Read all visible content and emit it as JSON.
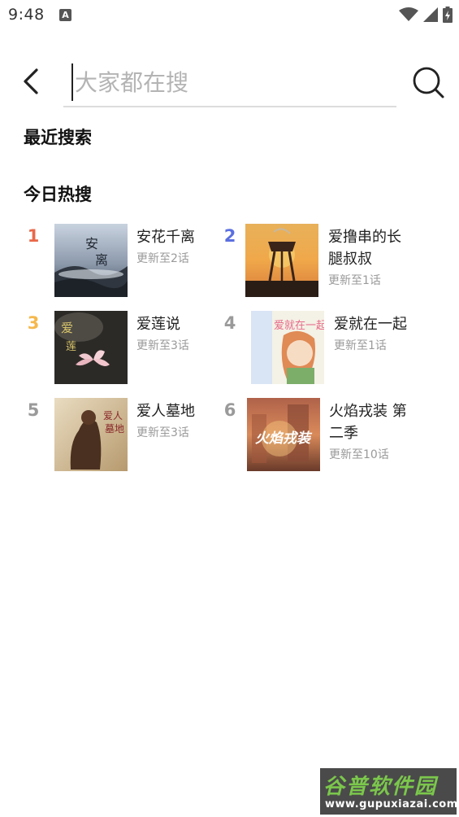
{
  "status_bar": {
    "time": "9:48",
    "notification_icon": "A"
  },
  "search": {
    "placeholder": "大家都在搜",
    "value": ""
  },
  "recent": {
    "title": "最近搜索"
  },
  "hot": {
    "title": "今日热搜",
    "items": [
      {
        "rank": "1",
        "rank_color": "#e8684a",
        "title": "安花千离",
        "title_line2": "",
        "update": "更新至2话"
      },
      {
        "rank": "2",
        "rank_color": "#5b6fe0",
        "title": "爱撸串的长",
        "title_line2": "腿叔叔",
        "update": "更新至1话"
      },
      {
        "rank": "3",
        "rank_color": "#f5b84c",
        "title": "爱莲说",
        "title_line2": "",
        "update": "更新至3话"
      },
      {
        "rank": "4",
        "rank_color": "#9a9a9a",
        "title": "爱就在一起",
        "title_line2": "",
        "update": "更新至1话"
      },
      {
        "rank": "5",
        "rank_color": "#9a9a9a",
        "title": "爱人墓地",
        "title_line2": "",
        "update": "更新至3话"
      },
      {
        "rank": "6",
        "rank_color": "#9a9a9a",
        "title": "火焰戎装 第",
        "title_line2": "二季",
        "update": "更新至10话"
      }
    ]
  },
  "watermark": {
    "brand": "谷普软件园",
    "url": "www.gupuxiazai.com"
  }
}
